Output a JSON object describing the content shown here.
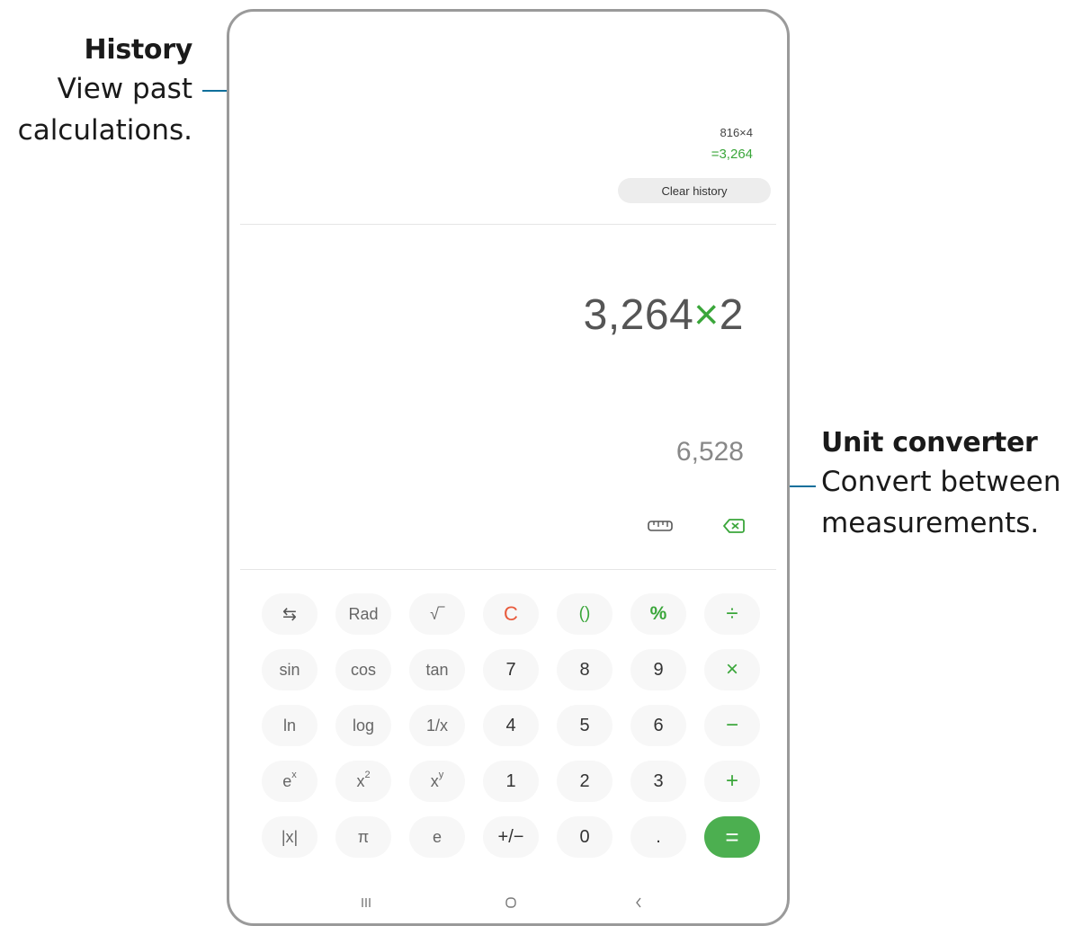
{
  "callouts": {
    "history": {
      "title": "History",
      "desc1": "View past",
      "desc2": "calculations."
    },
    "unit_converter": {
      "title": "Unit converter",
      "desc1": "Convert between",
      "desc2": "measurements."
    }
  },
  "history": {
    "expression": "816×4",
    "result": "=3,264",
    "clear_label": "Clear history"
  },
  "display": {
    "expression_value": "3,264",
    "expression_operator": "×",
    "expression_operand": "2",
    "preview": "6,528"
  },
  "tools": {
    "unit_converter_icon": "ruler-icon",
    "backspace_icon": "backspace-icon"
  },
  "keypad": {
    "row1": [
      "⇆",
      "Rad",
      "√‾",
      "C",
      "()",
      "%",
      "÷"
    ],
    "row2": [
      "sin",
      "cos",
      "tan",
      "7",
      "8",
      "9",
      "×"
    ],
    "row3": [
      "ln",
      "log",
      "1/x",
      "4",
      "5",
      "6",
      "−"
    ],
    "row4": [
      "e",
      "x",
      "x",
      "1",
      "2",
      "3",
      "+"
    ],
    "row4_sup": [
      "x",
      "2",
      "y"
    ],
    "row5": [
      "|x|",
      "π",
      "e",
      "+/−",
      "0",
      ".",
      "="
    ]
  },
  "navigation": {
    "recent_icon": "recent-apps-icon",
    "home_icon": "home-icon",
    "back_icon": "back-icon"
  },
  "colors": {
    "accent": "#3aa63a",
    "equals_bg": "#4caf50",
    "clear": "#e85a3c",
    "leader": "#0f6f9b"
  }
}
